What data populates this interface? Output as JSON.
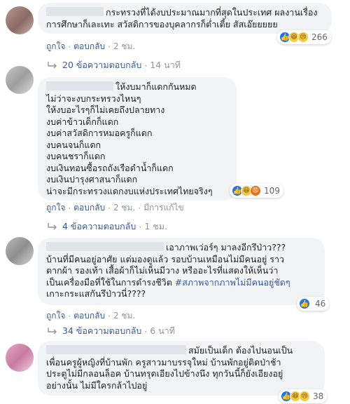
{
  "comments": [
    {
      "lines": [
        "กระทรวงที่ได้งบประมาณมากที่สุดในประเทศ ผลงานเรื่อง",
        "การศึกษาก็เละเทะ สวัสดิการของบุคลากรก็ต่ำเตี้ย สัสเอ๊ยยยยย"
      ],
      "reaction_count": "266",
      "actions": {
        "like": "ถูกใจ",
        "reply": "ตอบกลับ",
        "time": "2 ชม."
      },
      "replies": {
        "label": "20 ข้อความตอบกลับ",
        "time": "14 นาที"
      }
    },
    {
      "lines": [
        "ให้งบมาก็แดกกันหมด",
        "ไม่ว่าจะงบกระทรวงไหนๆ",
        "ให้งบอะไรๆก็ไม่เคยถึงปลายทาง",
        "งบค่าข้าวเด็กก็แดก",
        "งบค่าสวัสดิการหมอครูก็แดก",
        "งบคนจนก็แดก",
        "งบคนชราก็แดก",
        "งบเงินทอนซื้อรถถังเรือดำน้ำก็แดก",
        "งบเงินปารุงศาสนาก็แดก",
        "น่าจะมีกระทรวงแดกงบแห่งประเทศไทยจริงๆ"
      ],
      "reaction_count": "109",
      "actions": {
        "like": "ถูกใจ",
        "reply": "ตอบกลับ",
        "time": "2 ชม.",
        "edited": "มีการแก้ไข"
      },
      "replies": {
        "label": "4 ข้อความตอบกลับ",
        "time": "1 ชม."
      }
    },
    {
      "lines": [
        "เอาภาพเว่อร์ๆ มาลงอีกรึป่าว???",
        "บ้านที่มีคนอยู่อาศัย แต่มองดูแล้ว รอบบ้านเหมือนไม่มีคนอยู่ ราว",
        "ตากผ้า รองเท้า เสื้อผ้าก็ไม่เห็นมีวาง หรืออะไรที่แสดงให้เห็นว่า",
        "เป็นเครื่องมือที่ใช้ในการดำรงชีวิต",
        "เกาะกระแสกันรึป่าวนี่????"
      ],
      "hashtag": "#สภาพจากภาพไม่มีคนอยู่ชัดๆ",
      "reaction_count": "46",
      "actions": {
        "like": "ถูกใจ",
        "reply": "ตอบกลับ",
        "time": "2 ชม."
      },
      "replies": {
        "label": "34 ข้อความตอบกลับ",
        "time": "6 นาที"
      }
    },
    {
      "lines": [
        "สมัยเป็นเด็ก ต้องไปนอนเป็น",
        "เพื่อนครูผู้หญิงที่บ้านพัก ครูสาวมาบรรจุใหม่ บ้านพักอยู่ติดป่าช้า",
        "ประตูไม่มีกลอนล็อค บ้านทรุดเอียงไปข้างนึง ทุกวันนี้ก็ยังเอียงอยู่",
        "อย่างนั้น ไม่มีใครกล้าไปอยู่"
      ],
      "reaction_count": "38"
    }
  ],
  "colors": {
    "link": "#385898",
    "meta": "#90949c",
    "bubble": "#f2f3f5",
    "like": "#1877f2"
  }
}
